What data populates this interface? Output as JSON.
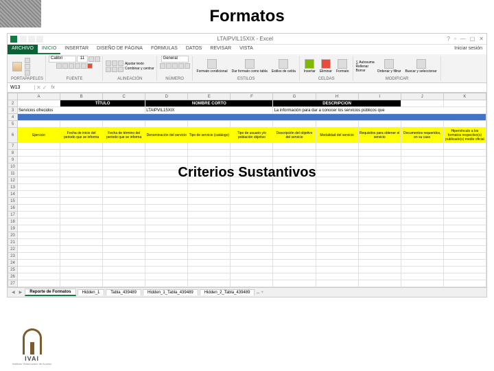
{
  "main_title": "Formatos",
  "subtitle": "Criterios Sustantivos",
  "window": {
    "title": "LTAIPVIL15XIX - Excel",
    "help": "?",
    "signin": "Iniciar sesión"
  },
  "ribbon_tabs": {
    "file": "ARCHIVO",
    "items": [
      "INICIO",
      "INSERTAR",
      "DISEÑO DE PÁGINA",
      "FÓRMULAS",
      "DATOS",
      "REVISAR",
      "VISTA"
    ]
  },
  "ribbon_groups": {
    "clipboard": "PORTAPAPELES",
    "font": "FUENTE",
    "font_name": "Calibri",
    "font_size": "11",
    "alignment": "ALINEACIÓN",
    "wrap": "Ajustar texto",
    "merge": "Combinar y centrar",
    "number": "NÚMERO",
    "number_format": "General",
    "styles": "ESTILOS",
    "cond_format": "Formato condicional",
    "format_table": "Dar formato como tabla",
    "cell_styles": "Estilos de celda",
    "cells": "CELDAS",
    "insert": "Insertar",
    "delete": "Eliminar",
    "format": "Formato",
    "editing": "MODIFICAR",
    "autosum": "Autosuma",
    "fill": "Rellenar",
    "clear": "Borrar",
    "sort": "Ordenar y filtrar",
    "find": "Buscar y seleccionar"
  },
  "formula_bar": {
    "name_box": "W13",
    "fx": "fx"
  },
  "col_headers": [
    "A",
    "B",
    "C",
    "D",
    "E",
    "F",
    "G",
    "H",
    "I",
    "J",
    "K"
  ],
  "row_headers": [
    "2",
    "3",
    "4",
    "5",
    "6",
    "7",
    "8",
    "9",
    "10",
    "11",
    "12",
    "13",
    "14",
    "15",
    "16",
    "17",
    "18",
    "19",
    "20",
    "21",
    "22",
    "23",
    "24",
    "25",
    "26",
    "27"
  ],
  "data": {
    "row2": {
      "B": "TÍTULO",
      "E": "NOMBRE CORTO",
      "H": "DESCRIPCION"
    },
    "row3": {
      "A": "Servicios ofrecidos",
      "D": "LTAIPVIL15XIX",
      "G": "La información para dar a conocer los servicios públicos que"
    },
    "row6": [
      "Ejercicio",
      "Fecha de inicio del periodo que se informa",
      "Fecha de término del periodo que se informa",
      "Denominación del servicio",
      "Tipo de servicio (catálogo)",
      "Tipo de usuario y/o población objetivo",
      "Descripción del objetivo del servicio",
      "Modalidad del servicio",
      "Requisitos para obtener el servicio",
      "Documentos requeridos, en su caso",
      "Hipervínculo a los formatos respectivo(s) publicado(s) medio oficial"
    ]
  },
  "sheet_tabs": {
    "active": "Reporte de Formatos",
    "others": [
      "Hidden_1",
      "Tabla_439489",
      "Hidden_1_Tabla_439489",
      "Hidden_2_Tabla_439489"
    ],
    "more": "...",
    "add": "+"
  },
  "logo": {
    "text": "IVAI",
    "sub": "Instituto Veracruzano de Acceso"
  }
}
